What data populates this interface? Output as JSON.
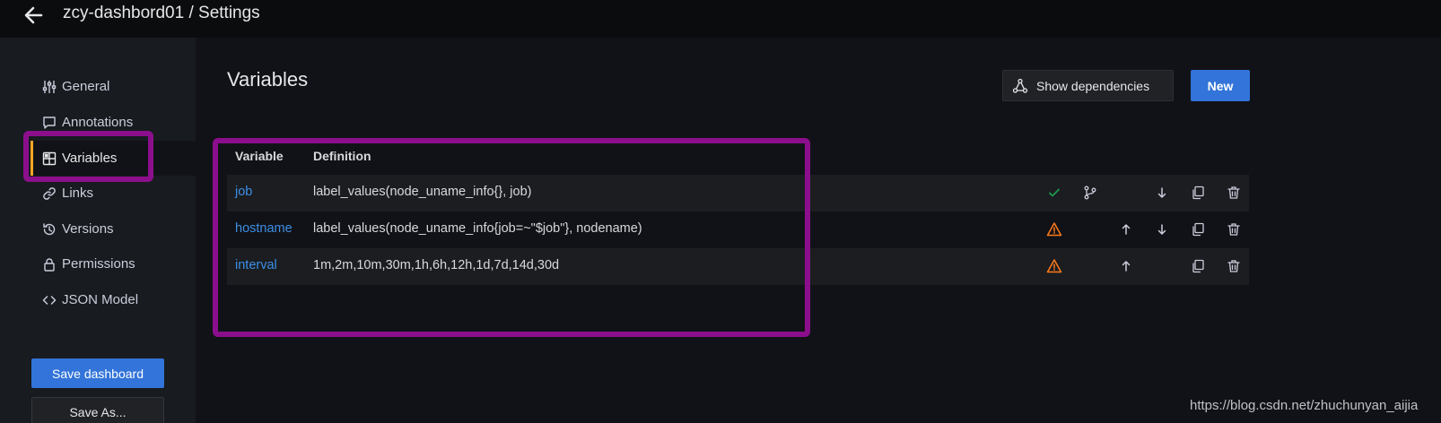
{
  "header": {
    "breadcrumb": "zcy-dashbord01 / Settings"
  },
  "sidebar": {
    "items": [
      {
        "label": "General",
        "icon": "sliders-icon"
      },
      {
        "label": "Annotations",
        "icon": "comment-icon"
      },
      {
        "label": "Variables",
        "icon": "grid-icon",
        "active": true
      },
      {
        "label": "Links",
        "icon": "link-icon"
      },
      {
        "label": "Versions",
        "icon": "history-icon"
      },
      {
        "label": "Permissions",
        "icon": "lock-icon"
      },
      {
        "label": "JSON Model",
        "icon": "code-icon"
      }
    ],
    "save_label": "Save dashboard",
    "save_as_label": "Save As..."
  },
  "main": {
    "title": "Variables",
    "show_dependencies_label": "Show dependencies",
    "new_label": "New",
    "table": {
      "headers": [
        "Variable",
        "Definition"
      ],
      "rows": [
        {
          "name": "job",
          "definition": "label_values(node_uname_info{}, job)",
          "status": "ok"
        },
        {
          "name": "hostname",
          "definition": "label_values(node_uname_info{job=~\"$job\"}, nodename)",
          "status": "warning"
        },
        {
          "name": "interval",
          "definition": "1m,2m,10m,30m,1h,6h,12h,1d,7d,14d,30d",
          "status": "warning"
        }
      ]
    }
  },
  "watermark": "https://blog.csdn.net/zhuchunyan_aijia",
  "colors": {
    "accent": "#3274d9",
    "link": "#3d8fe6",
    "active_border": "#f5a623",
    "highlight_box": "#8b0f8c",
    "ok": "#1a9b4b",
    "warning": "#ff7a1a"
  }
}
